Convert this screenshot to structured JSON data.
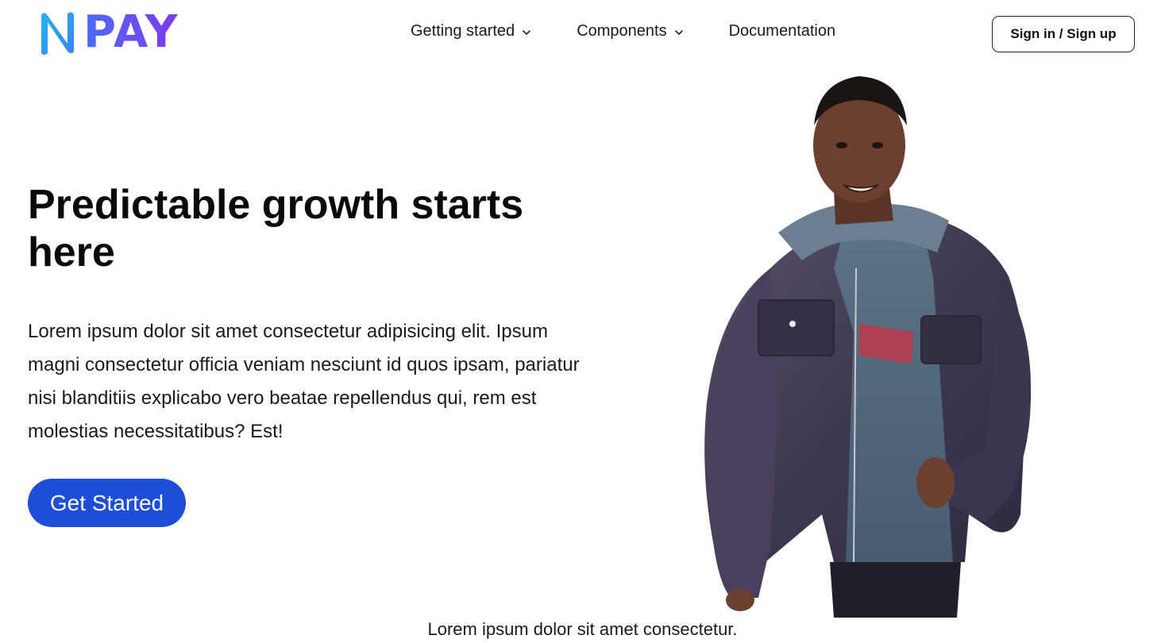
{
  "brand": {
    "logo_text": "PAY",
    "logo_mark": "N",
    "gradient_start": "#22b5f0",
    "gradient_end": "#7c3aed"
  },
  "nav": {
    "items": [
      {
        "label": "Getting started",
        "has_dropdown": true,
        "icon": "chevron-down-icon"
      },
      {
        "label": "Components",
        "has_dropdown": true,
        "icon": "chevron-down-icon"
      },
      {
        "label": "Documentation",
        "has_dropdown": false
      }
    ],
    "auth_label": "Sign in / Sign up"
  },
  "hero": {
    "title": "Predictable growth starts here",
    "description": "Lorem ipsum dolor sit amet consectetur adipisicing elit. Ipsum magni consectetur officia veniam nesciunt id quos ipsam, pariatur nisi blanditiis explicabo vero beatae repellendus qui, rem est molestias necessitatibus? Est!",
    "cta_label": "Get Started",
    "cta_color": "#1d4ed8",
    "image": "person-photo"
  },
  "footer": {
    "text": "Lorem ipsum dolor sit amet consectetur."
  }
}
